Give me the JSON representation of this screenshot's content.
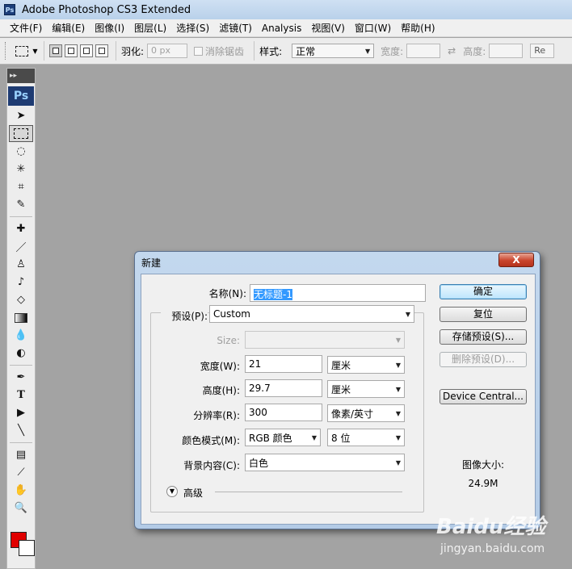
{
  "window": {
    "title": "Adobe Photoshop CS3 Extended",
    "app_icon": "Ps"
  },
  "menu": [
    "文件(F)",
    "编辑(E)",
    "图像(I)",
    "图层(L)",
    "选择(S)",
    "滤镜(T)",
    "Analysis",
    "视图(V)",
    "窗口(W)",
    "帮助(H)"
  ],
  "options_bar": {
    "feather_label": "羽化:",
    "feather_value": "0 px",
    "antialias_label": "消除锯齿",
    "style_label": "样式:",
    "style_value": "正常",
    "width_label": "宽度:",
    "height_label": "高度:",
    "refine_label": "Re"
  },
  "toolbox": {
    "logo": "Ps",
    "fg_color": "#e00000",
    "bg_color": "#ffffff"
  },
  "dialog": {
    "title": "新建",
    "close_label": "X",
    "name_label": "名称(N):",
    "name_value": "无标题-1",
    "preset_label": "预设(P):",
    "preset_value": "Custom",
    "size_label": "Size:",
    "size_value": "",
    "width_label": "宽度(W):",
    "width_value": "21",
    "width_unit": "厘米",
    "height_label": "高度(H):",
    "height_value": "29.7",
    "height_unit": "厘米",
    "resolution_label": "分辨率(R):",
    "resolution_value": "300",
    "resolution_unit": "像素/英寸",
    "color_mode_label": "颜色模式(M):",
    "color_mode_value": "RGB 颜色",
    "bit_depth_value": "8 位",
    "background_label": "背景内容(C):",
    "background_value": "白色",
    "advanced_label": "高级",
    "buttons": {
      "ok": "确定",
      "reset": "复位",
      "save_preset": "存储预设(S)...",
      "delete_preset": "删除预设(D)...",
      "device_central": "Device Central..."
    },
    "image_size_label": "图像大小:",
    "image_size_value": "24.9M"
  },
  "watermark": {
    "brand": "Baidu经验",
    "url": "jingyan.baidu.com"
  }
}
